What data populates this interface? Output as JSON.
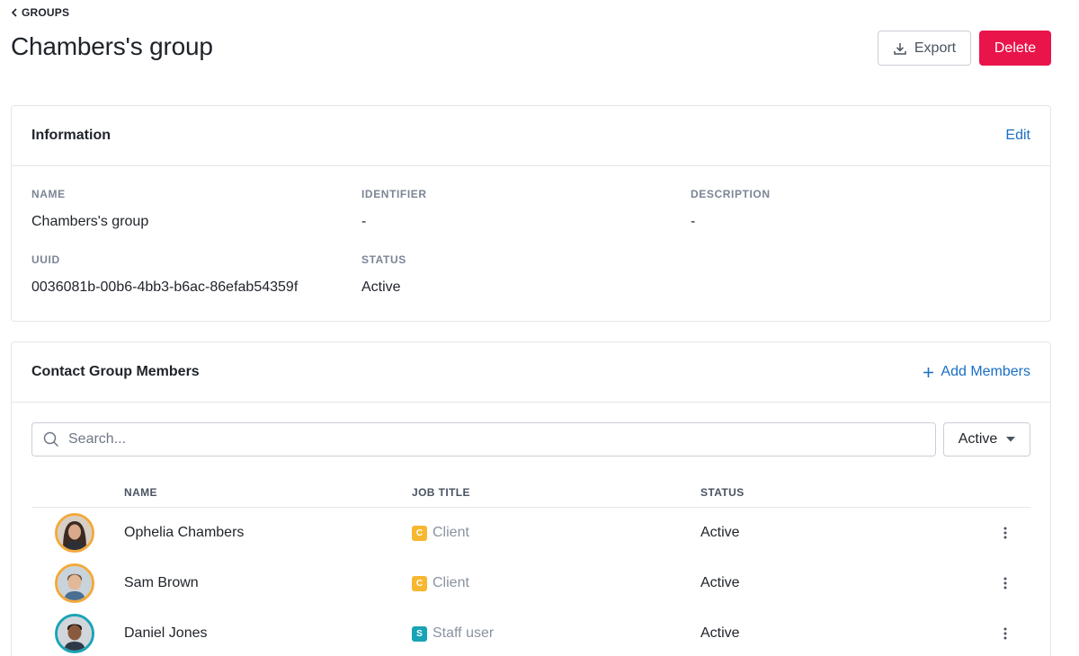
{
  "breadcrumb": {
    "label": "GROUPS"
  },
  "page": {
    "title": "Chambers's group"
  },
  "actions": {
    "export_label": "Export",
    "delete_label": "Delete"
  },
  "information": {
    "title": "Information",
    "edit_label": "Edit",
    "fields": {
      "name": {
        "label": "NAME",
        "value": "Chambers's group"
      },
      "identifier": {
        "label": "IDENTIFIER",
        "value": "-"
      },
      "description": {
        "label": "DESCRIPTION",
        "value": "-"
      },
      "uuid": {
        "label": "UUID",
        "value": "0036081b-00b6-4bb3-b6ac-86efab54359f"
      },
      "status": {
        "label": "STATUS",
        "value": "Active"
      }
    }
  },
  "members": {
    "title": "Contact Group Members",
    "add_label": "Add Members",
    "search": {
      "placeholder": "Search...",
      "value": ""
    },
    "status_filter": {
      "selected": "Active"
    },
    "columns": {
      "name": "NAME",
      "job_title": "JOB TITLE",
      "status": "STATUS"
    },
    "rows": [
      {
        "name": "Ophelia Chambers",
        "badge": "C",
        "job_title": "Client",
        "status": "Active",
        "type": "client"
      },
      {
        "name": "Sam Brown",
        "badge": "C",
        "job_title": "Client",
        "status": "Active",
        "type": "client"
      },
      {
        "name": "Daniel Jones",
        "badge": "S",
        "job_title": "Staff user",
        "status": "Active",
        "type": "staff"
      }
    ]
  },
  "colors": {
    "accent": "#1a6fc4",
    "danger": "#e8144a",
    "client_badge": "#f7b731",
    "staff_badge": "#19a3b6"
  }
}
